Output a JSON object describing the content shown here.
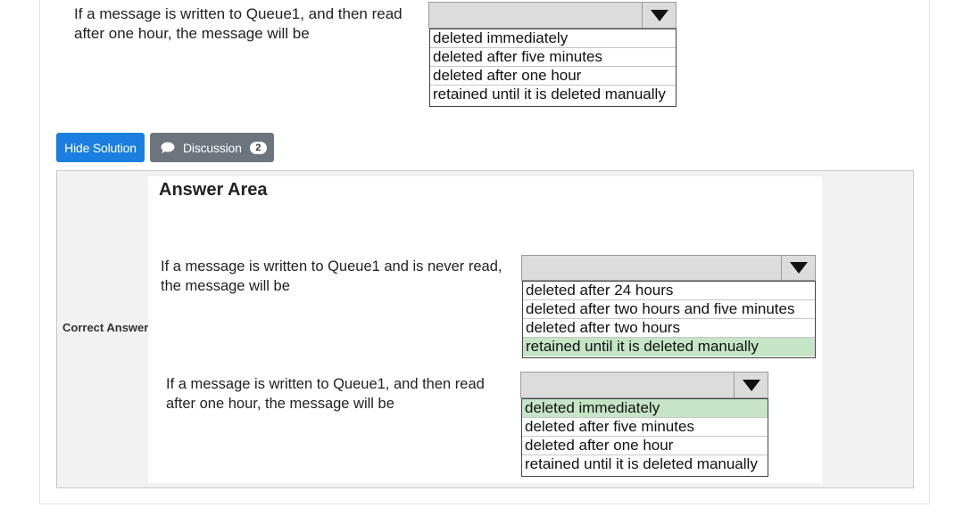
{
  "question_top": {
    "text_line1": "If a message is written to Queue1, and then read",
    "text_line2": "after one hour, the message will be",
    "options": [
      "deleted immediately",
      "deleted after five minutes",
      "deleted after one hour",
      "retained until it is deleted manually"
    ]
  },
  "buttons": {
    "hide_solution": "Hide Solution",
    "discussion": "Discussion",
    "discussion_count": "2"
  },
  "answer": {
    "label": "Correct Answer:",
    "title": "Answer Area",
    "q1": {
      "text_line1": "If a message is written to Queue1 and is never read,",
      "text_line2": "the message will be",
      "options": [
        "deleted after 24 hours",
        "deleted after two hours and five minutes",
        "deleted after two hours",
        "retained until it is deleted manually"
      ],
      "selected_index": 3
    },
    "q2": {
      "text_line1": "If a message is written to Queue1, and then read",
      "text_line2": "after one hour, the message will be",
      "options": [
        "deleted immediately",
        "deleted after five minutes",
        "deleted after one hour",
        "retained until it is deleted manually"
      ],
      "selected_index": 0
    }
  },
  "colors": {
    "primary_button": "#1a7fe0",
    "secondary_button": "#6c757d",
    "selected_option": "#c6e5c6"
  }
}
